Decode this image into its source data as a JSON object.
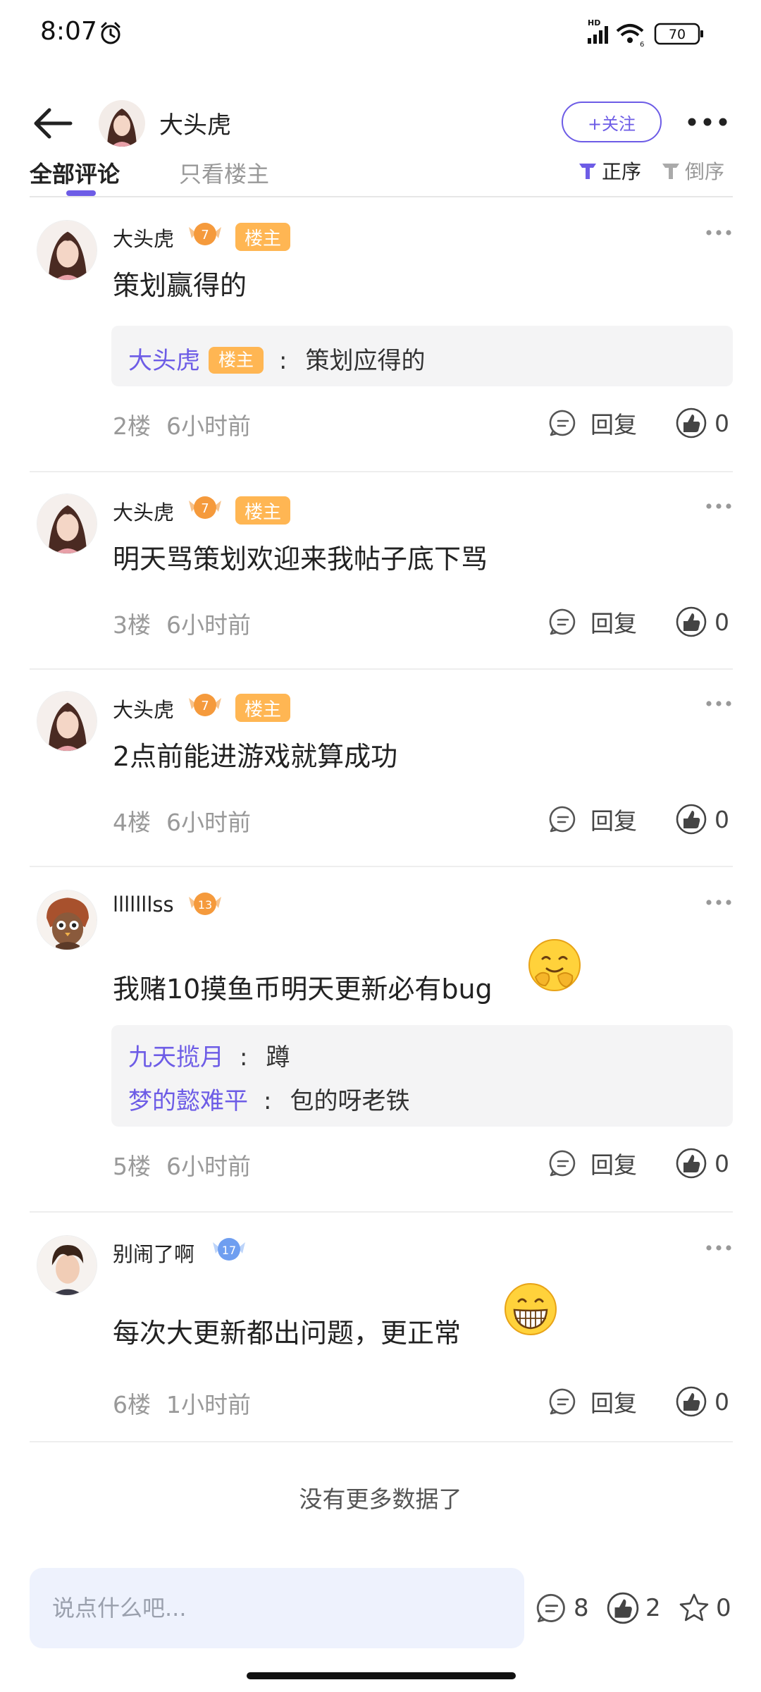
{
  "status_bar": {
    "time": "8:07",
    "battery": "70",
    "network": "HD",
    "sim": "6"
  },
  "header": {
    "user_name": "大头虎",
    "follow_label": "+关注"
  },
  "tabs": {
    "all": "全部评论",
    "owner_only": "只看楼主",
    "sort_asc": "正序",
    "sort_desc": "倒序"
  },
  "owner_tag": "楼主",
  "reply_label": "回复",
  "comments": [
    {
      "name": "大头虎",
      "level": "7",
      "is_owner": true,
      "text": "策划赢得的",
      "replies": [
        {
          "name": "大头虎",
          "is_owner": true,
          "text": "策划应得的"
        }
      ],
      "floor": "2楼",
      "time": "6小时前",
      "likes": "0"
    },
    {
      "name": "大头虎",
      "level": "7",
      "is_owner": true,
      "text": "明天骂策划欢迎来我帖子底下骂",
      "floor": "3楼",
      "time": "6小时前",
      "likes": "0"
    },
    {
      "name": "大头虎",
      "level": "7",
      "is_owner": true,
      "text": "2点前能进游戏就算成功",
      "floor": "4楼",
      "time": "6小时前",
      "likes": "0"
    },
    {
      "name": "lllllllss",
      "level": "13",
      "is_owner": false,
      "text": "我赌10摸鱼币明天更新必有bug",
      "emoji": "hugging-face-emoji",
      "replies": [
        {
          "name": "九天揽月",
          "text": "蹲"
        },
        {
          "name": "梦的懿难平",
          "text": "包的呀老铁"
        }
      ],
      "floor": "5楼",
      "time": "6小时前",
      "likes": "0"
    },
    {
      "name": "别闹了啊",
      "level": "17",
      "is_owner": false,
      "text": "每次大更新都出问题，更正常",
      "emoji": "grinning-face-emoji",
      "floor": "6楼",
      "time": "1小时前",
      "likes": "0"
    }
  ],
  "no_more_text": "没有更多数据了",
  "bottom_bar": {
    "placeholder": "说点什么吧...",
    "comment_count": "8",
    "like_count": "2",
    "star_count": "0"
  },
  "colors": {
    "accent": "#6d5ce6",
    "owner_tag": "#ffb653",
    "level_badge": "#f59a3c",
    "level_badge_blue": "#6f9ef0",
    "input_bg": "#eef2fd"
  }
}
